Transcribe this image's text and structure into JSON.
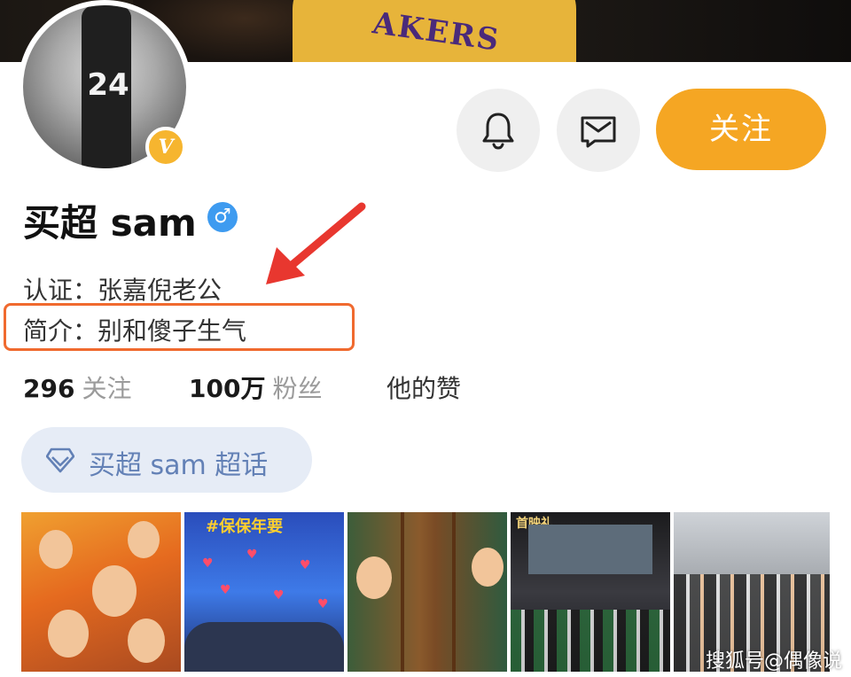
{
  "cover": {
    "jersey_text": "AKERS"
  },
  "avatar": {
    "player_number": "24",
    "verified_badge": "V"
  },
  "actions": {
    "follow_label": "关注"
  },
  "profile": {
    "name": "买超 sam",
    "gender_symbol": "♂",
    "verification": "认证：张嘉倪老公",
    "intro": "简介：别和傻子生气"
  },
  "stats": {
    "following_count": "296",
    "following_label": "关注",
    "fans_count": "100万",
    "fans_label": "粉丝",
    "likes_label": "他的赞"
  },
  "super_topic": {
    "label": "买超 sam 超话"
  },
  "photos": [
    {
      "caption": ""
    },
    {
      "caption": "#保保年要"
    },
    {
      "caption": ""
    },
    {
      "caption": "首映礼"
    },
    {
      "caption": ""
    }
  ],
  "watermark": "搜狐号@偶像说",
  "colors": {
    "accent_orange": "#f5a623",
    "highlight_box": "#f06a2f",
    "arrow_red": "#e8372f",
    "gender_blue": "#3e9bf0",
    "topic_text": "#6381b6"
  },
  "icons": [
    "bell-icon",
    "message-icon",
    "diamond-icon",
    "male-icon",
    "verified-v-icon"
  ]
}
